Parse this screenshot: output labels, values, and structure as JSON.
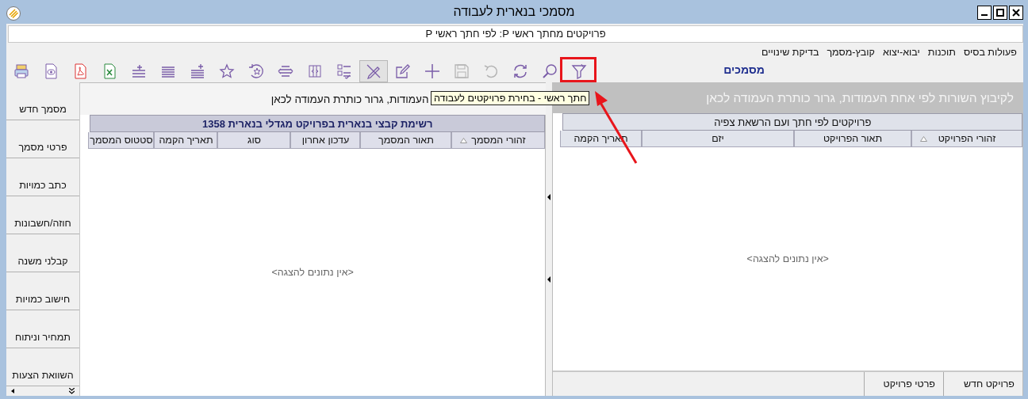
{
  "window": {
    "title": "מסמכי בנארית לעבודה"
  },
  "subtitle": "פרויקטים מחתך ראשי P: לפי חתך ראשי P",
  "menu": [
    "פעולות בסיס",
    "תוכנות",
    "יבוא-יצוא",
    "קובץ-מסמך",
    "בדיקת שינויים"
  ],
  "toolbar": [
    {
      "kind": "print",
      "disabled": false,
      "pressed": false
    },
    {
      "kind": "preview",
      "disabled": false,
      "pressed": false
    },
    {
      "kind": "pdf",
      "disabled": false,
      "pressed": false
    },
    {
      "kind": "excel",
      "disabled": false,
      "pressed": false
    },
    {
      "kind": "insert-row",
      "disabled": false,
      "pressed": false
    },
    {
      "kind": "lines",
      "disabled": false,
      "pressed": false
    },
    {
      "kind": "append-row",
      "disabled": false,
      "pressed": false
    },
    {
      "kind": "star",
      "disabled": false,
      "pressed": false
    },
    {
      "kind": "star-undo",
      "disabled": false,
      "pressed": false
    },
    {
      "kind": "align",
      "disabled": false,
      "pressed": false
    },
    {
      "kind": "columns",
      "disabled": false,
      "pressed": false
    },
    {
      "kind": "checklist",
      "disabled": false,
      "pressed": false
    },
    {
      "kind": "pen-off",
      "disabled": false,
      "pressed": true
    },
    {
      "kind": "edit",
      "disabled": false,
      "pressed": false
    },
    {
      "kind": "add",
      "disabled": false,
      "pressed": false
    },
    {
      "kind": "save",
      "disabled": true,
      "pressed": false
    },
    {
      "kind": "undo",
      "disabled": true,
      "pressed": false
    },
    {
      "kind": "refresh",
      "disabled": false,
      "pressed": false
    },
    {
      "kind": "search",
      "disabled": false,
      "pressed": false
    },
    {
      "kind": "filter",
      "disabled": false,
      "pressed": false
    }
  ],
  "section_title": "מסמכים",
  "tooltip": "חתך ראשי - בחירת פרויקטים לעבודה",
  "sidebar": {
    "items": [
      "מסמך חדש",
      "פרטי מסמך",
      "כתב כמויות",
      "חוזה/חשבונות",
      "קבלני משנה",
      "חישוב כמויות",
      "תמחיר וניתוח",
      "השוואת הצעות"
    ]
  },
  "documents_grid": {
    "group_hint": "העמודות, גרור כותרת העמודה לכאן",
    "band": "רשימת קבצי בנארית בפרויקט מגדלי בנארית 1358",
    "columns": [
      {
        "label": "זהורי המסמך",
        "sorted": true
      },
      {
        "label": "תאור המסמך",
        "sorted": false
      },
      {
        "label": "עדכון אחרון",
        "sorted": false
      },
      {
        "label": "סוג",
        "sorted": false
      },
      {
        "label": "תאריך הקמה",
        "sorted": false
      },
      {
        "label": "סטטוס המסמך",
        "sorted": false
      }
    ],
    "empty": "<אין נתונים להצגה>"
  },
  "projects_grid": {
    "group_hint": "לקיבוץ השורות לפי אחת העמודות, גרור כותרת העמודה לכאן",
    "band": "פרויקטים לפי חתך ועם הרשאת צפיה",
    "columns": [
      {
        "label": "זהורי הפרויקט",
        "sorted": true
      },
      {
        "label": "תאור הפרויקט",
        "sorted": false
      },
      {
        "label": "יזם",
        "sorted": false
      },
      {
        "label": "תאריך הקמה",
        "sorted": false
      }
    ],
    "empty": "<אין נתונים להצגה>"
  },
  "bottom_tabs": [
    "פרויקט חדש",
    "פרטי פרויקט"
  ]
}
